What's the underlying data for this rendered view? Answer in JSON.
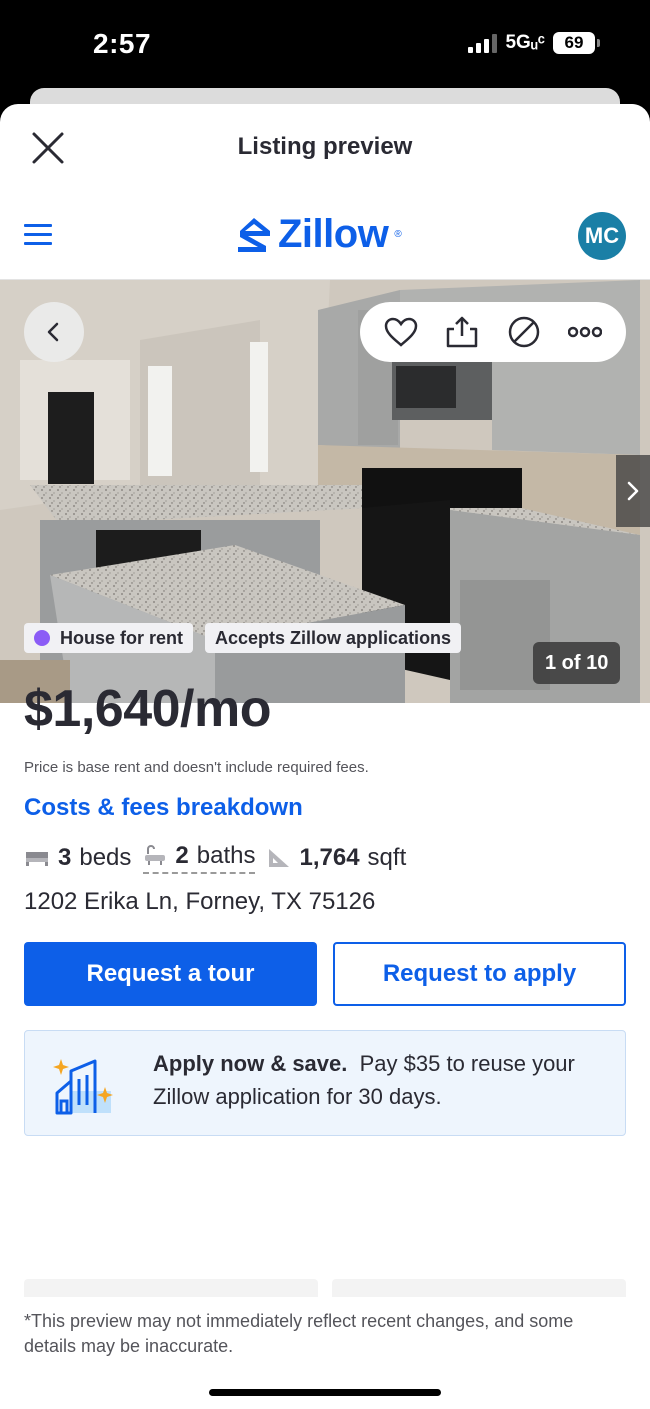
{
  "status_bar": {
    "time": "2:57",
    "network": "5Gᵤᶜ",
    "battery": "69"
  },
  "preview": {
    "title": "Listing preview"
  },
  "header": {
    "logo": "Zillow",
    "avatar_initials": "MC"
  },
  "photo": {
    "counter": "1 of 10"
  },
  "listing": {
    "tags": [
      "House for rent",
      "Accepts Zillow applications"
    ],
    "price": "$1,640/mo",
    "price_note": "Price is base rent and doesn't include required fees.",
    "fees_link": "Costs & fees breakdown",
    "beds": "3",
    "beds_label": "beds",
    "baths": "2",
    "baths_label": "baths",
    "sqft": "1,764",
    "sqft_label": "sqft",
    "address": "1202 Erika Ln, Forney, TX 75126"
  },
  "actions": {
    "tour": "Request a tour",
    "apply": "Request to apply"
  },
  "promo": {
    "headline": "Apply now & save.",
    "body": "Pay $35 to reuse your Zillow application for 30 days."
  },
  "disclaimer": "*This preview may not immediately reflect recent changes, and some details may be inaccurate.",
  "colors": {
    "brand": "#0d5fe8",
    "avatar": "#1a7fa6",
    "rent_dot": "#8b5cf6"
  },
  "icons": [
    "close-icon",
    "menu-icon",
    "zillow-logo-icon",
    "back-chevron-icon",
    "heart-icon",
    "share-icon",
    "hide-icon",
    "more-icon",
    "next-chevron-icon",
    "bed-icon",
    "bath-icon",
    "sqft-icon",
    "apply-building-icon"
  ]
}
